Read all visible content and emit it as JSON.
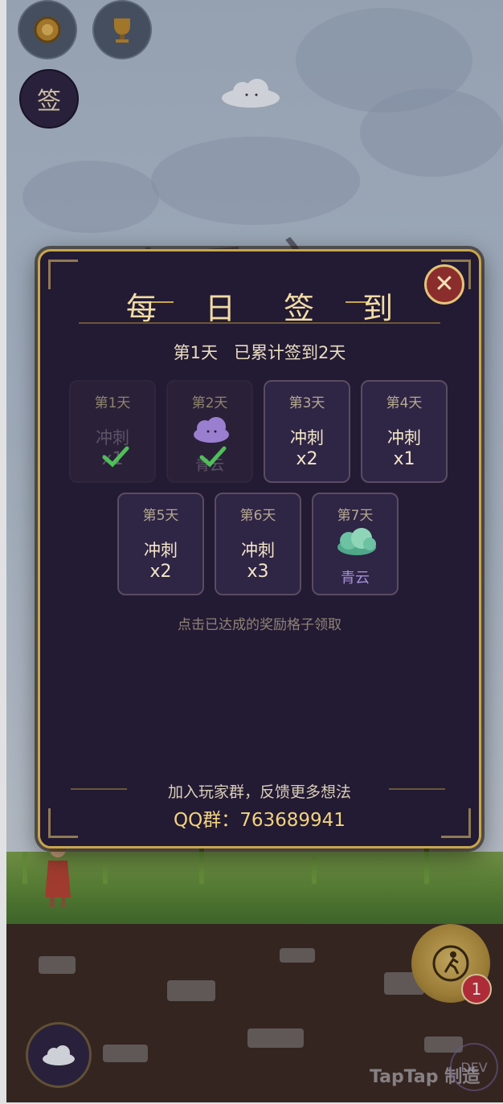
{
  "hud": {
    "sign_label": "签",
    "top_buttons": [
      "medal-icon",
      "trophy-icon"
    ]
  },
  "dialog": {
    "title": "每 日 签 到",
    "summary": "第1天   已累计签到2天",
    "close_icon": "close-icon",
    "rewards": [
      {
        "day": "第1天",
        "name": "冲刺",
        "qty": "x1",
        "claimed": true
      },
      {
        "day": "第2天",
        "name": "",
        "qty": "",
        "sub": "青云",
        "icon": "cloud-purple-icon",
        "claimed": true
      },
      {
        "day": "第3天",
        "name": "冲刺",
        "qty": "x2",
        "claimed": false
      },
      {
        "day": "第4天",
        "name": "冲刺",
        "qty": "x1",
        "claimed": false
      },
      {
        "day": "第5天",
        "name": "冲刺",
        "qty": "x2",
        "claimed": false
      },
      {
        "day": "第6天",
        "name": "冲刺",
        "qty": "x3",
        "claimed": false
      },
      {
        "day": "第7天",
        "name": "",
        "qty": "",
        "sub": "青云",
        "icon": "cloud-green-icon",
        "claimed": false
      }
    ],
    "hint": "点击已达成的奖励格子领取",
    "group_text": "加入玩家群，反馈更多想法",
    "qq_text": "QQ群：763689941"
  },
  "bottom": {
    "badge_count": "1",
    "watermark": "TapTap 制造",
    "dev_label": "DEV"
  },
  "colors": {
    "dialog_bg": "#231a33",
    "gold": "#c9a64c",
    "check_green": "#4fbf5a",
    "badge_red": "#c4323c"
  }
}
